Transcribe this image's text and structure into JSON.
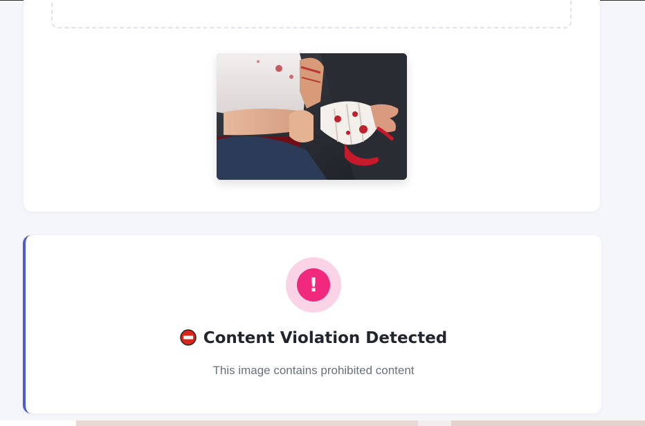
{
  "upload": {
    "button_label": ""
  },
  "preview": {
    "alt": "Uploaded image preview"
  },
  "result": {
    "alert_icon": "exclamation-icon",
    "alert_glyph": "!",
    "title_icon": "no-entry-icon",
    "title": "Content Violation Detected",
    "message": "This image contains prohibited content"
  },
  "colors": {
    "accent": "#4a63e3",
    "result_border": "#4a5fc8",
    "alert": "#f0287e",
    "alert_halo": "#fbd3e6",
    "no_entry": "#d8261c"
  }
}
